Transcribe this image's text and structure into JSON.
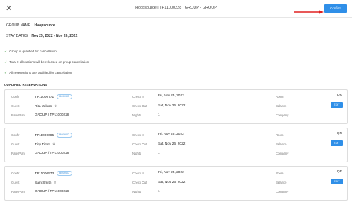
{
  "header": {
    "close": "✕",
    "title": "Hoopsource | TP11000228 | GROUP - GROUP",
    "confirm_label": "Confirm"
  },
  "group": {
    "name_label": "GROUP NAME",
    "name": "Hoopsource",
    "stay_label": "STAY DATES",
    "stay": "Nov 25, 2022 - Nov 26, 2022"
  },
  "checks": [
    "Group is qualified for cancellation",
    "Total 0 allocations will be released on group cancellation",
    "All reservations are qualified for cancellation"
  ],
  "qualified_title": "QUALIFIED RESERVATIONS",
  "labels": {
    "confir": "Confir",
    "guest": "Guest",
    "rate_plan": "Rate Plan",
    "check_in": "Check In",
    "check_out": "Check Out",
    "nights": "Nights",
    "room": "Room",
    "balance": "Balance",
    "company": "Company",
    "badge": "BOOKED",
    "edit": "EDIT",
    "room_type": "QR"
  },
  "reservations": [
    {
      "confir": "TP11000771",
      "guest": "Rita Wilson",
      "rate_plan": "GROUP / TP11000228",
      "check_in": "Fri, Nov 25, 2022",
      "check_out": "Sat, Nov 26, 2022",
      "nights": "1"
    },
    {
      "confir": "TP11000085",
      "guest": "Tiny Timm",
      "rate_plan": "GROUP / TP11000228",
      "check_in": "Fri, Nov 25, 2022",
      "check_out": "Sat, Nov 26, 2022",
      "nights": "1"
    },
    {
      "confir": "TP11000573",
      "guest": "Sam Smith",
      "rate_plan": "GROUP / TP11000228",
      "check_in": "Fri, Nov 25, 2022",
      "check_out": "Sat, Nov 26, 2022",
      "nights": "1"
    }
  ]
}
